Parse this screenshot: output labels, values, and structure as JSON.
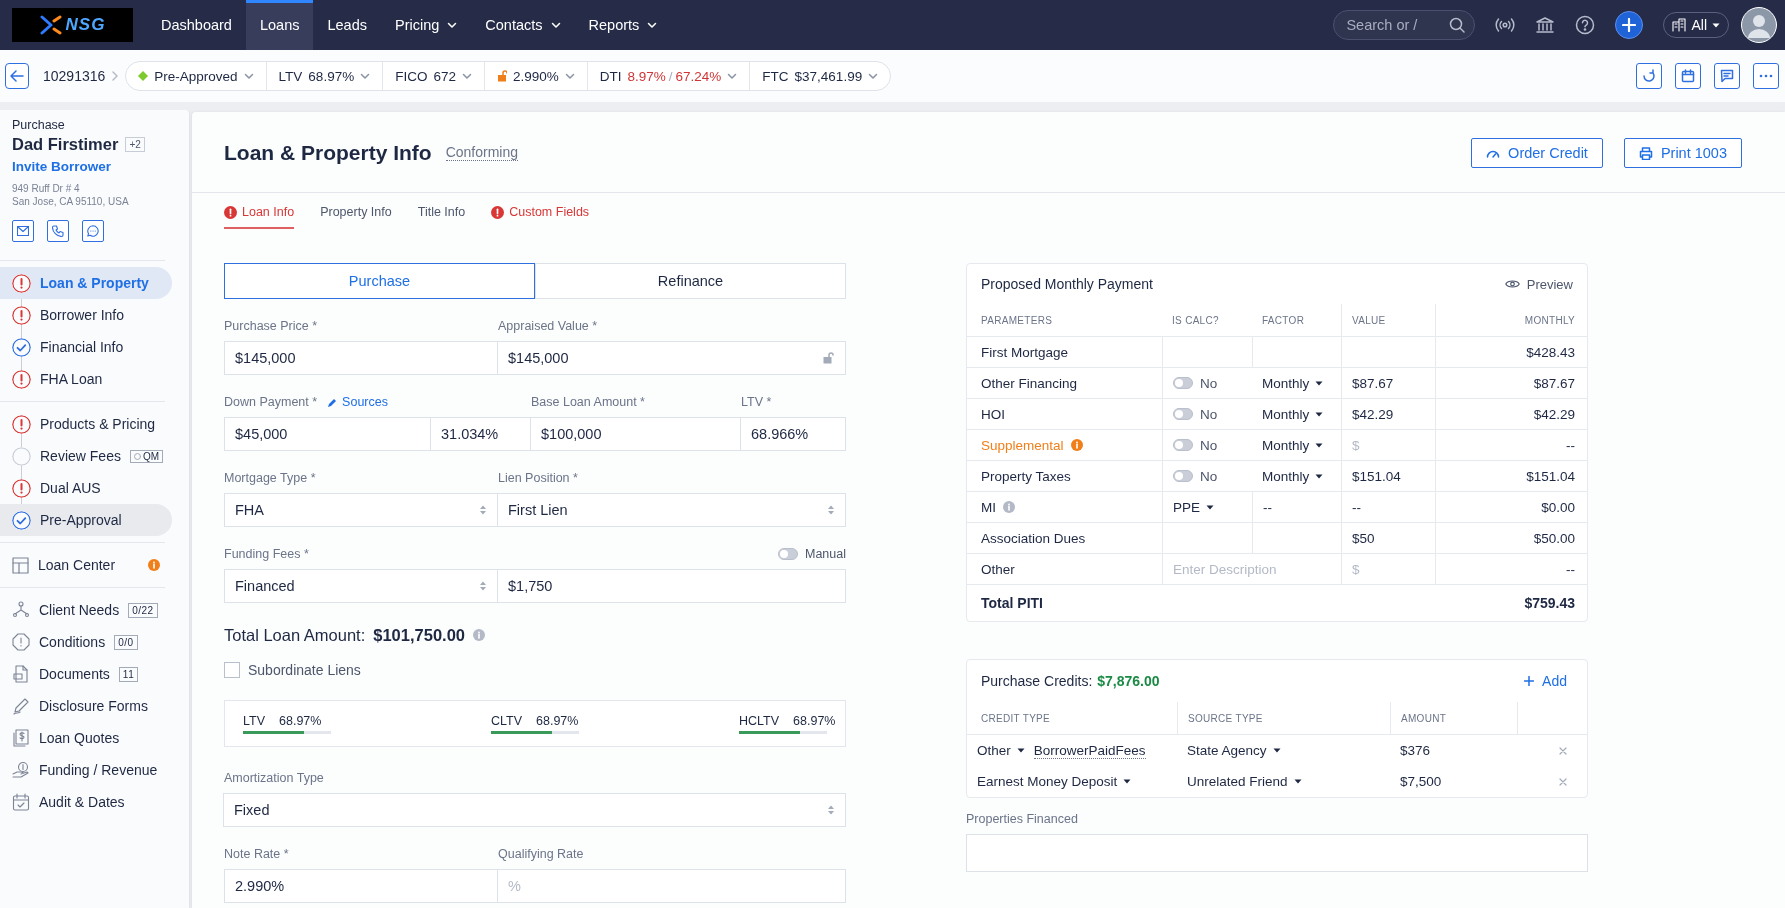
{
  "nav": {
    "logo": "NSG",
    "items": [
      {
        "label": "Dashboard",
        "selected": false,
        "dropdown": false
      },
      {
        "label": "Loans",
        "selected": true,
        "dropdown": false
      },
      {
        "label": "Leads",
        "selected": false,
        "dropdown": false
      },
      {
        "label": "Pricing",
        "selected": false,
        "dropdown": true
      },
      {
        "label": "Contacts",
        "selected": false,
        "dropdown": true
      },
      {
        "label": "Reports",
        "selected": false,
        "dropdown": true
      }
    ],
    "search": {
      "placeholder": "Search or /"
    },
    "scope": "All"
  },
  "loan_bar": {
    "loan_number": "10291316",
    "chips": [
      {
        "kind": "status",
        "text": "Pre-Approved"
      },
      {
        "kind": "metric",
        "label": "LTV",
        "value": "68.97%"
      },
      {
        "kind": "metric",
        "label": "FICO",
        "value": "672"
      },
      {
        "kind": "rate",
        "value": "2.990%"
      },
      {
        "kind": "dti",
        "label": "DTI",
        "value": "8.97%",
        "separator": "/",
        "value2": "67.24%"
      },
      {
        "kind": "metric",
        "label": "FTC",
        "value": "$37,461.99"
      }
    ]
  },
  "borrower": {
    "purpose": "Purchase",
    "name": "Dad Firstimer",
    "extra": "+2",
    "invite": "Invite Borrower",
    "address": [
      "949 Ruff Dr # 4",
      "San Jose, CA 95110, USA"
    ]
  },
  "step_groups": [
    {
      "steps": [
        {
          "label": "Loan & Property",
          "warning": true,
          "complete": false,
          "selected": true,
          "hovered": false
        },
        {
          "label": "Borrower Info",
          "warning": true,
          "complete": false,
          "selected": false,
          "hovered": false
        },
        {
          "label": "Financial Info",
          "warning": false,
          "complete": true,
          "selected": false,
          "hovered": false
        },
        {
          "label": "FHA Loan",
          "warning": true,
          "complete": false,
          "selected": false,
          "hovered": false
        }
      ]
    },
    {
      "steps": [
        {
          "label": "Products & Pricing",
          "warning": true,
          "complete": false,
          "selected": false,
          "hovered": false
        },
        {
          "label": "Review Fees",
          "warning": false,
          "complete": false,
          "selected": false,
          "hovered": false,
          "badge": "QM"
        },
        {
          "label": "Dual AUS",
          "warning": true,
          "complete": false,
          "selected": false,
          "hovered": false
        },
        {
          "label": "Pre-Approval",
          "warning": false,
          "complete": true,
          "selected": false,
          "hovered": true
        }
      ]
    }
  ],
  "loan_center": {
    "label": "Loan Center",
    "alert": true
  },
  "tools": [
    {
      "label": "Client Needs",
      "badge": "0/22"
    },
    {
      "label": "Conditions",
      "badge": "0/0"
    },
    {
      "label": "Documents",
      "badge": "11"
    },
    {
      "label": "Disclosure Forms"
    },
    {
      "label": "Loan Quotes"
    },
    {
      "label": "Funding / Revenue"
    },
    {
      "label": "Audit & Dates"
    }
  ],
  "page": {
    "title": "Loan & Property Info",
    "subtitle": "Conforming",
    "buttons": [
      "Order Credit",
      "Print 1003"
    ],
    "tabs": [
      {
        "label": "Loan Info",
        "error": true,
        "selected": true
      },
      {
        "label": "Property Info",
        "error": false,
        "selected": false
      },
      {
        "label": "Title Info",
        "error": false,
        "selected": false
      },
      {
        "label": "Custom Fields",
        "error": true,
        "selected": false
      }
    ]
  },
  "loan_form": {
    "purpose_toggle": [
      {
        "label": "Purchase",
        "selected": true
      },
      {
        "label": "Refinance",
        "selected": false
      }
    ],
    "purchase_price": {
      "label": "Purchase Price *",
      "value": "$145,000"
    },
    "appraised_value": {
      "label": "Appraised Value *",
      "value": "$145,000"
    },
    "down_payment": {
      "label": "Down Payment *",
      "link": "Sources",
      "value": "$45,000",
      "percent": "31.034%"
    },
    "base_loan_amount": {
      "label": "Base Loan Amount *",
      "value": "$100,000"
    },
    "ltv": {
      "label": "LTV *",
      "value": "68.966%"
    },
    "mortgage_type": {
      "label": "Mortgage Type *",
      "value": "FHA"
    },
    "lien_position": {
      "label": "Lien Position *",
      "value": "First Lien"
    },
    "funding_fees": {
      "label": "Funding Fees *",
      "value": "Financed",
      "amount": "$1,750",
      "manual_label": "Manual",
      "manual_on": false
    },
    "total_loan_amount": {
      "label": "Total Loan Amount:",
      "value": "$101,750.00"
    },
    "subordinate_liens": {
      "label": "Subordinate Liens",
      "checked": false
    },
    "ratios": [
      {
        "label": "LTV",
        "value": "68.97%",
        "level": 0.69
      },
      {
        "label": "CLTV",
        "value": "68.97%",
        "level": 0.69
      },
      {
        "label": "HCLTV",
        "value": "68.97%",
        "level": 0.69
      }
    ],
    "amortization_type": {
      "label": "Amortization Type",
      "value": "Fixed"
    },
    "note_rate": {
      "label": "Note Rate *",
      "value": "2.990%"
    },
    "qualifying_rate": {
      "label": "Qualifying Rate",
      "placeholder": "%"
    }
  },
  "payment": {
    "title": "Proposed Monthly Payment",
    "preview": "Preview",
    "columns": [
      "PARAMETERS",
      "IS CALC?",
      "FACTOR",
      "VALUE",
      "MONTHLY"
    ],
    "rows": [
      {
        "kind": "plain",
        "parameter": "First Mortgage",
        "monthly": "$428.43"
      },
      {
        "kind": "toggle",
        "parameter": "Other Financing",
        "toggle_on": false,
        "toggle_label": "No",
        "factor": "Monthly",
        "value": "$87.67",
        "monthly": "$87.67"
      },
      {
        "kind": "toggle",
        "parameter": "HOI",
        "toggle_on": false,
        "toggle_label": "No",
        "factor": "Monthly",
        "value": "$42.29",
        "monthly": "$42.29"
      },
      {
        "kind": "toggle",
        "parameter": "Supplemental",
        "warning": true,
        "toggle_on": false,
        "toggle_label": "No",
        "factor": "Monthly",
        "value_placeholder": "$",
        "monthly": "--"
      },
      {
        "kind": "toggle",
        "parameter": "Property Taxes",
        "toggle_on": false,
        "toggle_label": "No",
        "factor": "Monthly",
        "value": "$151.04",
        "monthly": "$151.04"
      },
      {
        "kind": "select",
        "parameter": "MI",
        "info": true,
        "calc": "PPE",
        "factor": "--",
        "value": "--",
        "monthly": "$0.00"
      },
      {
        "kind": "plain",
        "parameter": "Association Dues",
        "value": "$50",
        "monthly": "$50.00"
      },
      {
        "kind": "other",
        "parameter": "Other",
        "description_placeholder": "Enter Description",
        "value_placeholder": "$",
        "monthly": "--"
      }
    ],
    "total": {
      "label": "Total PITI",
      "value": "$759.43"
    }
  },
  "credits": {
    "title": "Purchase Credits:",
    "total": "$7,876.00",
    "add": "Add",
    "columns": [
      "CREDIT TYPE",
      "SOURCE TYPE",
      "AMOUNT"
    ],
    "rows": [
      {
        "credit_type": "Other",
        "description": "BorrowerPaidFees",
        "source_type": "State Agency",
        "amount": "$376"
      },
      {
        "credit_type": "Earnest Money Deposit",
        "source_type": "Unrelated Friend",
        "amount": "$7,500"
      }
    ]
  },
  "properties_financed": {
    "label": "Properties Financed"
  }
}
